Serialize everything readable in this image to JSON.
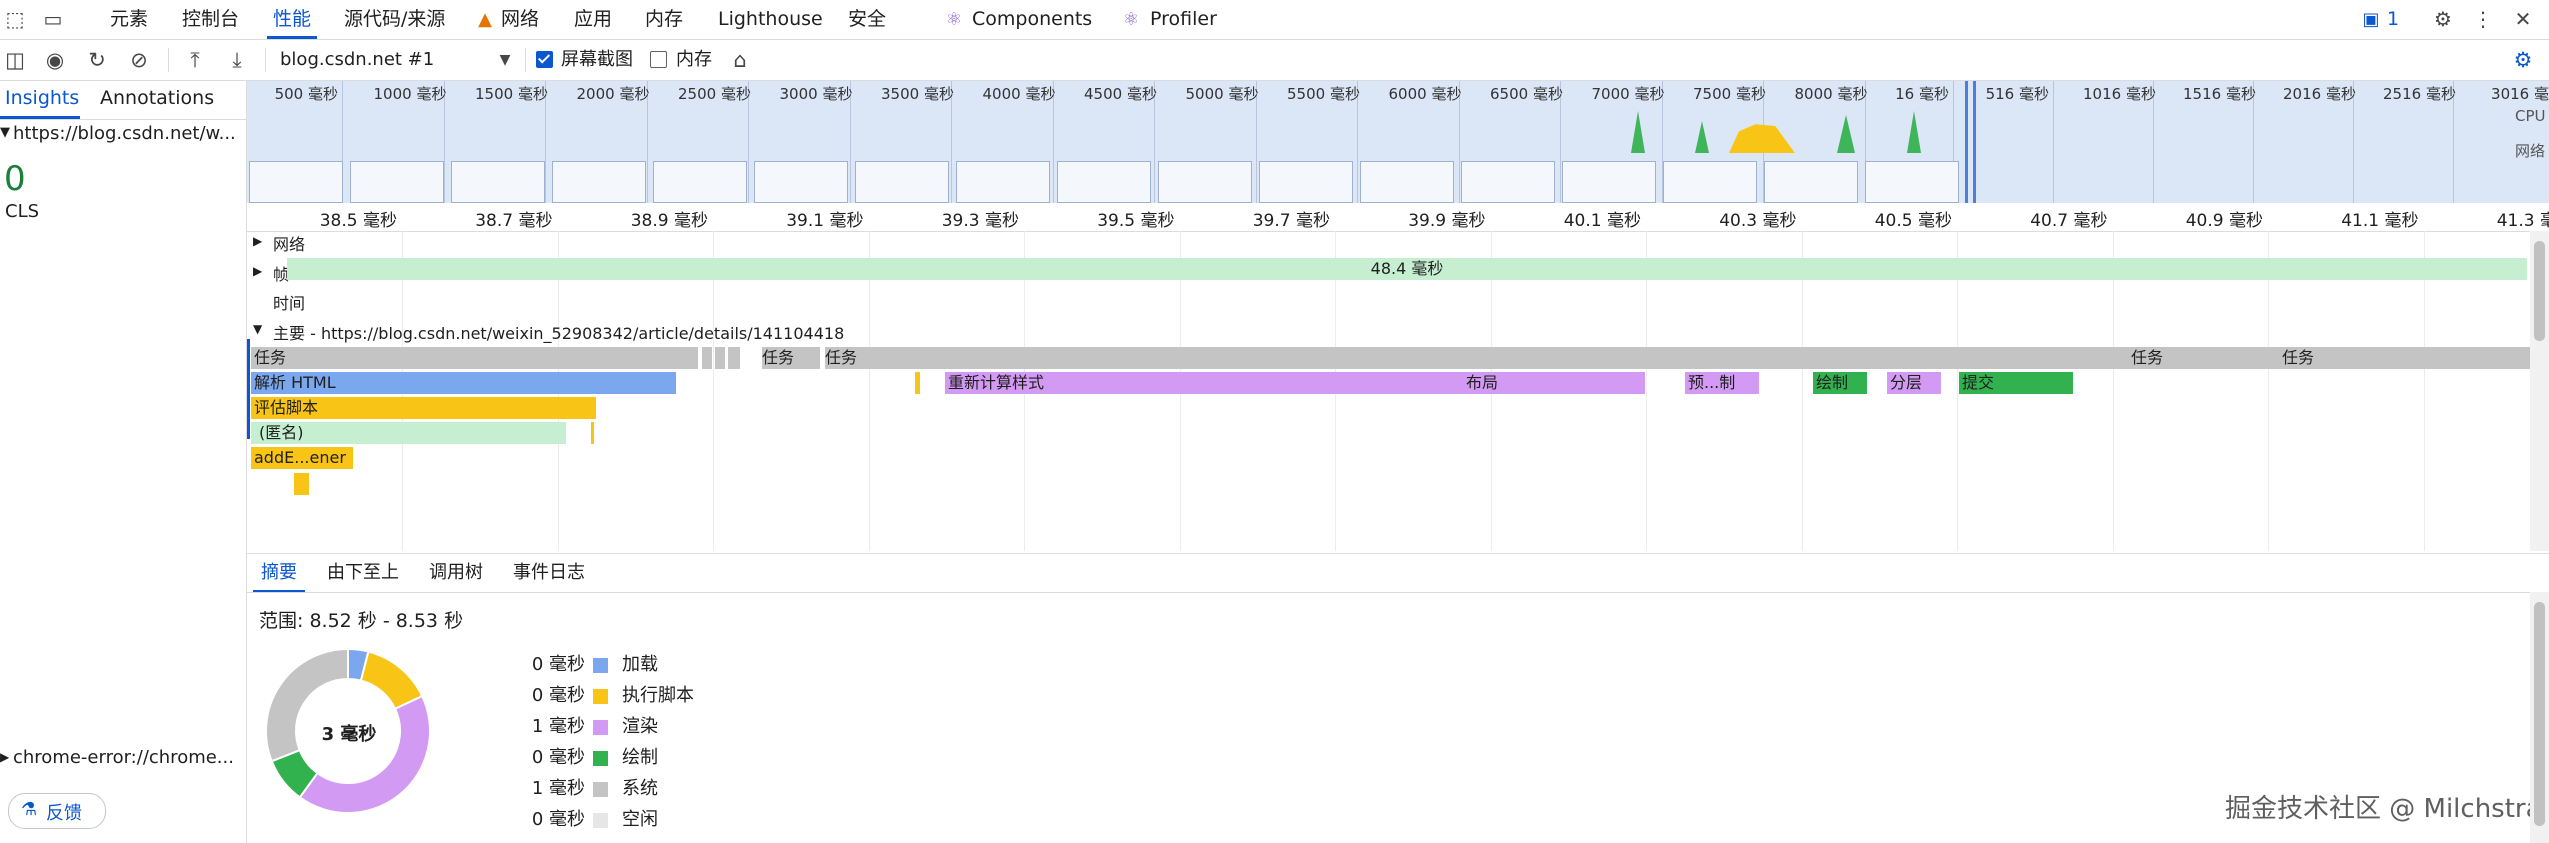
{
  "tabbar": {
    "tabs": [
      "元素",
      "控制台",
      "性能",
      "源代码/来源",
      "网络",
      "应用",
      "内存",
      "Lighthouse",
      "安全",
      "Components",
      "Profiler"
    ],
    "active_tab": "性能",
    "issues_count": "1"
  },
  "toolbar": {
    "target_select": "blog.csdn.net #1",
    "screenshot_label": "屏幕截图",
    "screenshot_checked": true,
    "memory_label": "内存",
    "memory_checked": false
  },
  "sidebar": {
    "tabs": [
      "Insights",
      "Annotations"
    ],
    "active_tab": "Insights",
    "url_item": "https://blog.csdn.net/w...",
    "cls_value": "0",
    "cls_label": "CLS",
    "error_item": "chrome-error://chrome...",
    "feedback_label": "反馈"
  },
  "overview": {
    "ticks": [
      "500 毫秒",
      "1000 毫秒",
      "1500 毫秒",
      "2000 毫秒",
      "2500 毫秒",
      "3000 毫秒",
      "3500 毫秒",
      "4000 毫秒",
      "4500 毫秒",
      "5000 毫秒",
      "5500 毫秒",
      "6000 毫秒",
      "6500 毫秒",
      "7000 毫秒",
      "7500 毫秒",
      "8000 毫秒",
      "16 毫秒",
      "516 毫秒",
      "1016 毫秒",
      "1516 毫秒",
      "2016 毫秒",
      "2516 毫秒",
      "3016 毫"
    ],
    "cpu_label": "CPU",
    "network_label": "网络"
  },
  "ruler": {
    "ticks": [
      "38.5 毫秒",
      "38.7 毫秒",
      "38.9 毫秒",
      "39.1 毫秒",
      "39.3 毫秒",
      "39.5 毫秒",
      "39.7 毫秒",
      "39.9 毫秒",
      "40.1 毫秒",
      "40.3 毫秒",
      "40.5 毫秒",
      "40.7 毫秒",
      "40.9 毫秒",
      "41.1 毫秒",
      "41.3 毫秒"
    ]
  },
  "tracks": {
    "network": "网络",
    "frames": "帧",
    "frame_duration": "48.4 毫秒",
    "timings": "时间",
    "main": "主要 - https://blog.csdn.net/weixin_52908342/article/details/141104418",
    "task": "任务",
    "parse_html": "解析 HTML",
    "evaluate_script": "评估脚本",
    "anonymous": "(匿名)",
    "add_listener": "addE...ener",
    "recalc_style": "重新计算样式",
    "layout": "布局",
    "pre_paint": "预...制",
    "paint": "绘制",
    "layerize": "分层",
    "commit": "提交"
  },
  "bottom": {
    "tabs": [
      "摘要",
      "由下至上",
      "调用树",
      "事件日志"
    ],
    "active_tab": "摘要",
    "range": "范围: 8.52 秒 - 8.53 秒",
    "total": "3 毫秒",
    "legend": [
      {
        "value": "0 毫秒",
        "label": "加载",
        "color": "#7ba7ee"
      },
      {
        "value": "0 毫秒",
        "label": "执行脚本",
        "color": "#f8c516"
      },
      {
        "value": "1 毫秒",
        "label": "渲染",
        "color": "#d39af3"
      },
      {
        "value": "0 毫秒",
        "label": "绘制",
        "color": "#32b24f"
      },
      {
        "value": "1 毫秒",
        "label": "系统",
        "color": "#c4c4c4"
      },
      {
        "value": "0 毫秒",
        "label": "空闲",
        "color": "#e6e6e6"
      }
    ],
    "donut_fractions": [
      0.04,
      0.14,
      0.42,
      0.09,
      0.31
    ],
    "watermark": "掘金技术社区 @ Milchstra"
  }
}
